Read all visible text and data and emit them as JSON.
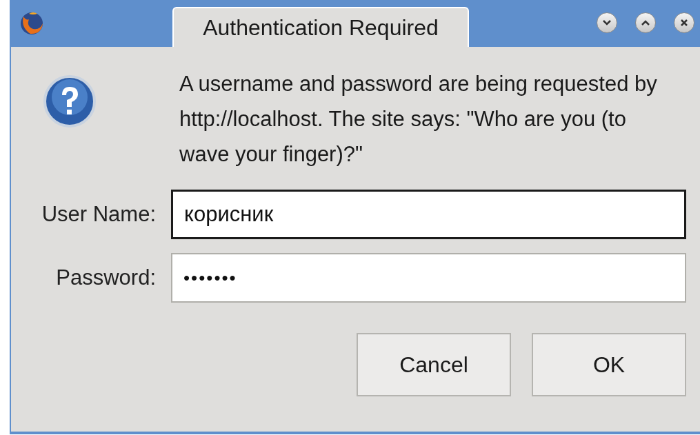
{
  "window": {
    "title": "Authentication Required"
  },
  "message": "A username and password are being requested by http://localhost. The site says: \"Who are you (to wave your finger)?\"",
  "fields": [
    {
      "label": "User Name:",
      "value": "корисник",
      "focused": true
    },
    {
      "label": "Password:",
      "value": "•••••••",
      "focused": false
    }
  ],
  "buttons": [
    "Cancel",
    "OK"
  ]
}
